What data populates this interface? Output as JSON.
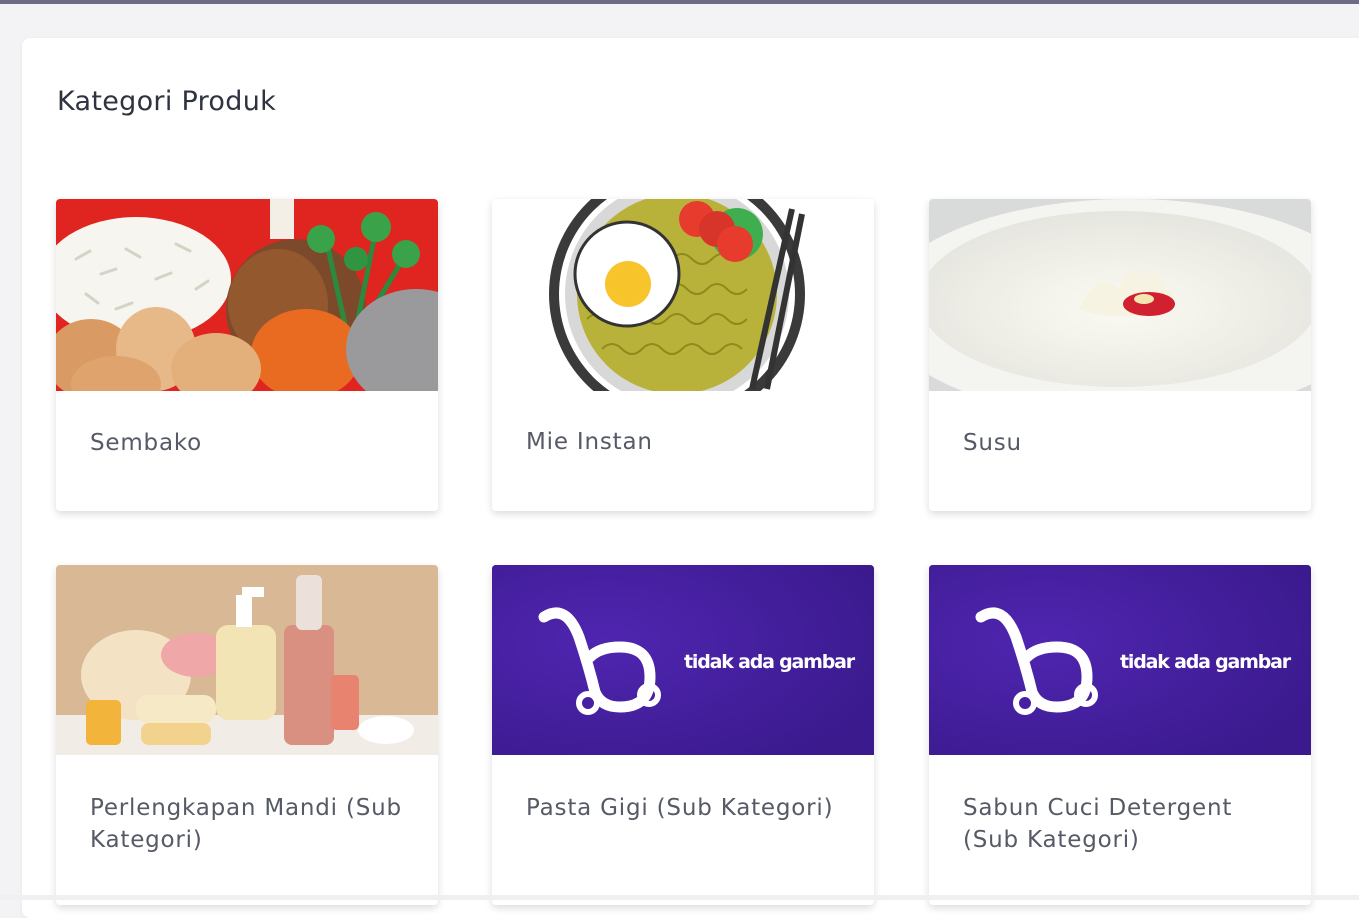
{
  "page": {
    "title": "Kategori Produk"
  },
  "placeholder_text": "tidak ada gambar",
  "colors": {
    "accent_purple": "#3f1d97",
    "topbar": "#6e6a86"
  },
  "categories": [
    {
      "label": "Sembako",
      "image": "groceries-image"
    },
    {
      "label": "Mie Instan",
      "image": "noodles-image"
    },
    {
      "label": "Susu",
      "image": "milk-image"
    },
    {
      "label": "Perlengkapan Mandi (Sub Kategori)",
      "image": "toiletries-image"
    },
    {
      "label": "Pasta Gigi (Sub Kategori)",
      "image": "no-image-placeholder"
    },
    {
      "label": "Sabun Cuci Detergent (Sub Kategori)",
      "image": "no-image-placeholder"
    }
  ]
}
